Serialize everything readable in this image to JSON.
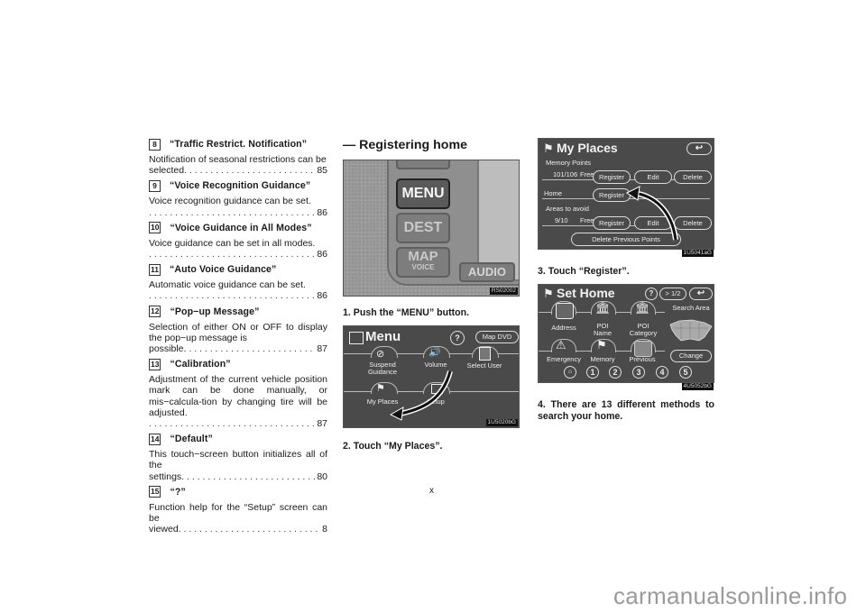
{
  "settings_items": [
    {
      "num": "8",
      "title": "“Traffic Restrict. Notification”",
      "desc": "Notification of seasonal restrictions can be selected.",
      "page": "85",
      "dots_inline": true
    },
    {
      "num": "9",
      "title": "“Voice Recognition Guidance”",
      "desc": "Voice recognition guidance can be set.",
      "page": "86",
      "dots_inline": false
    },
    {
      "num": "10",
      "title": "“Voice Guidance in All Modes”",
      "desc": "Voice guidance can be set in all modes.",
      "page": "86",
      "dots_inline": false
    },
    {
      "num": "11",
      "title": "“Auto Voice Guidance”",
      "desc": "Automatic voice guidance can be set.",
      "page": "86",
      "dots_inline": false
    },
    {
      "num": "12",
      "title": "“Pop−up Message”",
      "desc": "Selection of either ON or OFF to display the pop−up message is possible.",
      "page": "87",
      "dots_inline": true
    },
    {
      "num": "13",
      "title": "“Calibration”",
      "desc": "Adjustment of the current vehicle position mark can be done manually, or mis−calcula-tion by changing tire will be adjusted.",
      "page": "87",
      "dots_inline": false
    },
    {
      "num": "14",
      "title": "“Default”",
      "desc": "This touch−screen button initializes all of the settings.",
      "page": "80",
      "dots_inline": true
    },
    {
      "num": "15",
      "title": "“?”",
      "desc": "Function help for the “Setup” screen can be viewed.",
      "page": "8",
      "dots_inline": true
    }
  ],
  "section": {
    "title": "— Registering home"
  },
  "head_unit": {
    "buttons": [
      "MENU",
      "DEST",
      "MAP",
      "VOICE",
      "AUDIO"
    ],
    "image_code": "RS02002"
  },
  "steps": {
    "step1": "1.  Push the “MENU” button.",
    "step2": "2.  Touch “My Places”.",
    "step3": "3.  Touch “Register”.",
    "step4": "4. There are 13 different methods to search your home."
  },
  "menu_screen": {
    "title": "Menu",
    "help": "?",
    "map_dvd": "Map DVD",
    "items": [
      "Suspend Guidance",
      "Volume",
      "Select User",
      "My Places",
      "Setup"
    ],
    "image_code": "1U5020bG"
  },
  "my_places_screen": {
    "title": "My Places",
    "memory_points_label": "Memory Points",
    "memory_count": "101/106",
    "free_label": "Free",
    "register": "Register",
    "edit": "Edit",
    "delete": "Delete",
    "home_label": "Home",
    "areas_label": "Areas to avoid",
    "areas_count": "9/10",
    "delete_previous": "Delete Previous Points",
    "image_code": "1U5041aG"
  },
  "set_home_screen": {
    "title": "Set Home",
    "help": "?",
    "page_btn": "> 1/2",
    "search_area": "Search Area",
    "items": [
      "Address",
      "POI Name",
      "POI Category",
      "Emergency",
      "Memory",
      "Previous"
    ],
    "poi": "POI",
    "name": "Name",
    "category": "Category",
    "change": "Change",
    "presets": [
      "1",
      "2",
      "3",
      "4",
      "5"
    ],
    "image_code": "4U5052bG"
  },
  "page_number": "x",
  "watermark": "carmanualsonline.info"
}
